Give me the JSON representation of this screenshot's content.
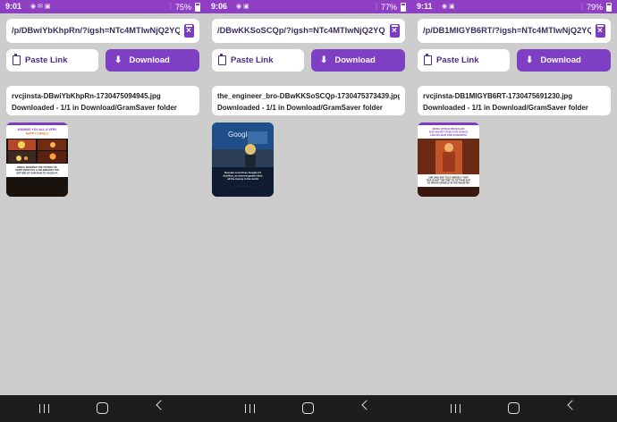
{
  "panels": [
    {
      "status": {
        "time": "9:01",
        "battery": "75%"
      },
      "url": "/p/DBwiYbKhpRn/?igsh=NTc4MTIwNjQ2YQ==",
      "paste_label": "Paste Link",
      "download_label": "Download",
      "file_name": "rvcjinsta-DBwiYbKhpRn-1730475094945.jpg",
      "status_text": "Downloaded - 1/1 in Download/GramSaver folder",
      "thumb": {
        "headline": "WISHING YOU ALL A VERY HAPPY DIWALI!",
        "caption": "DIWALI SIGNIFIES THE VICTORY OF GOOD OVER EVIL & CELEBRATES THE RETURN OF SHRI RAM TO AYODHYA",
        "colors": [
          "#1a120c",
          "#d8832b",
          "#f6d55b"
        ]
      }
    },
    {
      "status": {
        "time": "9:06",
        "battery": "77%"
      },
      "url": "/DBwKKSoSCQp/?igsh=NTc4MTIwNjQ2YQ==",
      "paste_label": "Paste Link",
      "download_label": "Download",
      "file_name": "the_engineer_bro-DBwKKSoSCQp-1730475373439.jpg",
      "status_text": "Downloaded - 1/1 in Download/GramSaver folder",
      "thumb": {
        "headline": "Google",
        "caption": "Russian court fines Google 2.5 decillion, an amount greater than all the money in the world",
        "colors": [
          "#0d1a33",
          "#2a6cc8",
          "#e6c85a"
        ]
      }
    },
    {
      "status": {
        "time": "9:11",
        "battery": "79%"
      },
      "url": "/p/DB1MIGYB6RT/?igsh=NTc4MTIwNjQ2YQ==",
      "paste_label": "Paste Link",
      "download_label": "Download",
      "file_name": "rvcjinsta-DB1MIGYB6RT-1730475691230.jpg",
      "status_text": "Downloaded - 1/1 in Download/GramSaver folder",
      "thumb": {
        "headline": "NORA FATEHI REVEALED SHE WASN'T PAID FOR SONGS LIKE DILBAR AND KAMARIYA",
        "caption": "SHE SAID SHE TOLD HERSELF THAT THIS IS NOT THE TIME TO GET PAID BUT TO PROVE HERSELF IN THE INDUSTRY",
        "colors": [
          "#3a1810",
          "#c2562a",
          "#f0b26a"
        ]
      }
    }
  ],
  "accent": "#7f3fc4"
}
